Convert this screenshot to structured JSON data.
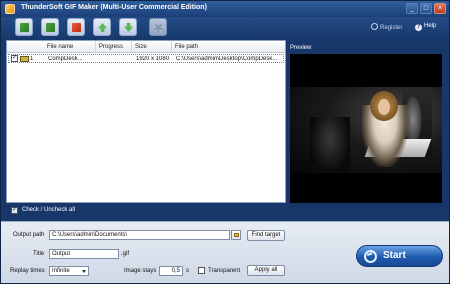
{
  "window": {
    "title": "ThunderSoft GIF Maker (Multi-User Commercial Edition)",
    "min_label": "_",
    "max_label": "□",
    "close_label": "×"
  },
  "toolbar": {
    "buttons": [
      {
        "icon": "add-file-icon"
      },
      {
        "icon": "add-folder-icon"
      },
      {
        "icon": "delete-icon"
      },
      {
        "icon": "move-up-icon"
      },
      {
        "icon": "move-down-icon"
      },
      {
        "icon": "settings-gear-icon"
      }
    ],
    "register_label": "Register",
    "help_label": "Help",
    "help_icon_text": "?"
  },
  "file_list": {
    "columns": [
      "File name",
      "Progress",
      "Size",
      "File path"
    ],
    "rows": [
      {
        "checked": true,
        "check_mark": "✓",
        "index": "1",
        "name": "CompDesk...",
        "progress": "",
        "size": "1920 x 1080",
        "path": "C:\\Users\\admin\\Desktop\\CompDesk..."
      }
    ],
    "check_all_label": "Check / Uncheck all",
    "check_all_mark": "✓"
  },
  "preview": {
    "label": "Preview"
  },
  "output": {
    "path_label": "Output path",
    "path_value": "C:\\Users\\admin\\Documents\\",
    "find_target_label": "Find target",
    "title_label": "Title",
    "title_value": "Output",
    "title_ext": ".gif",
    "replay_label": "Replay times",
    "replay_value": "Infinite",
    "image_stays_label": "Image stays",
    "image_stays_value": "0,5",
    "image_stays_unit": "s",
    "transparent_label": "Transparent",
    "apply_all_label": "Apply all",
    "start_label": "Start"
  }
}
